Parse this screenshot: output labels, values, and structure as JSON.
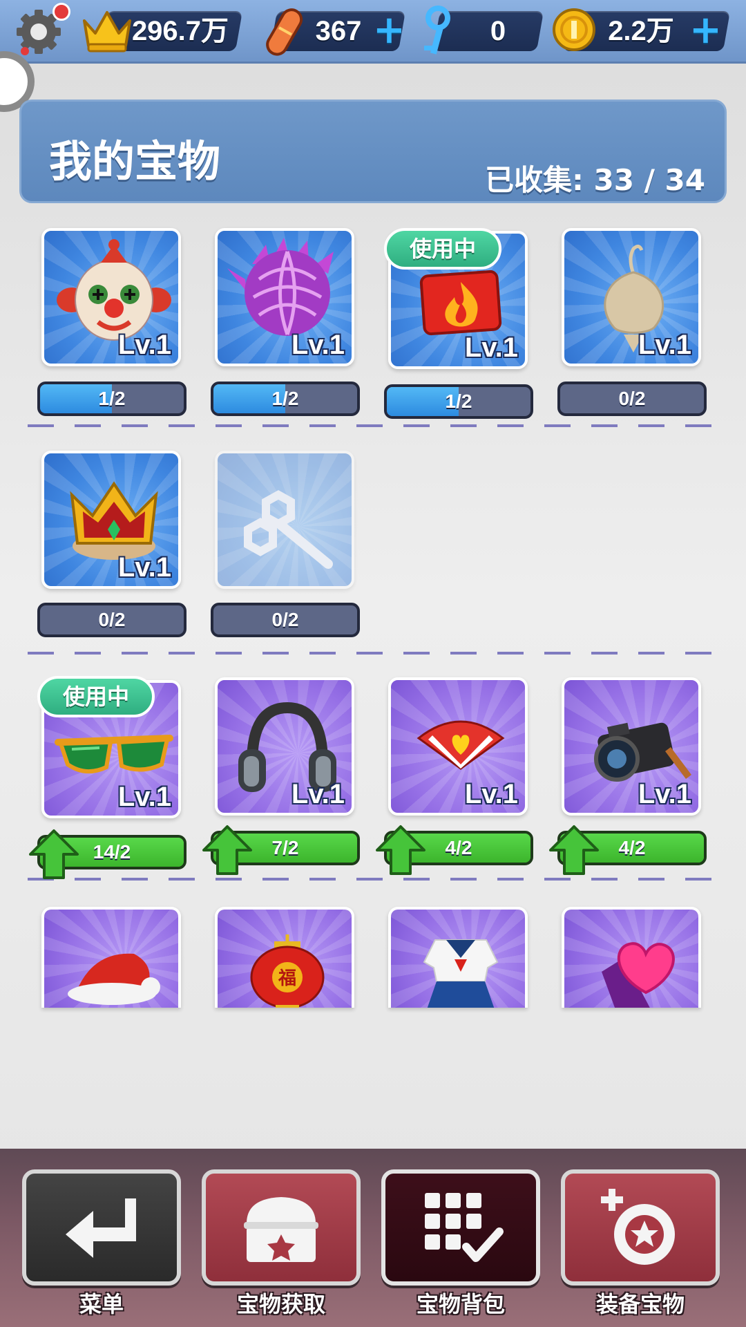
{
  "topbar": {
    "icons": [
      "settings-gear-icon",
      "crown-icon",
      "hoverboard-icon",
      "key-icon",
      "coin-icon"
    ],
    "crowns": "296.7万",
    "hoverboards": "367",
    "keys": "0",
    "coins": "2.2万",
    "plus": "+"
  },
  "header": {
    "title": "我的宝物",
    "collected_label": "已收集:",
    "collected_value": "33 / 34"
  },
  "badge": {
    "in_use": "使用中"
  },
  "items": [
    {
      "icon": "clown-mask-icon",
      "level": "Lv.1",
      "progress_text": "1/2",
      "progress": 0.5,
      "color": "blue"
    },
    {
      "icon": "purple-flower-icon",
      "level": "Lv.1",
      "progress_text": "1/2",
      "progress": 0.5,
      "color": "blue"
    },
    {
      "icon": "fire-badge-icon",
      "level": "Lv.1",
      "progress_text": "1/2",
      "progress": 0.5,
      "color": "blue",
      "in_use": true
    },
    {
      "icon": "onion-charm-icon",
      "level": "Lv.1",
      "progress_text": "0/2",
      "progress": 0,
      "color": "blue"
    },
    {
      "icon": "golden-crown-icon",
      "level": "Lv.1",
      "progress_text": "0/2",
      "progress": 0,
      "color": "blue"
    },
    {
      "icon": "wind-up-key-icon",
      "progress_text": "0/2",
      "progress": 0,
      "color": "blue",
      "locked": true
    },
    {
      "icon": "sunglasses-icon",
      "level": "Lv.1",
      "progress_text": "14/2",
      "progress": 1,
      "color": "purple",
      "in_use": true,
      "upgradable": true
    },
    {
      "icon": "headphones-icon",
      "level": "Lv.1",
      "progress_text": "7/2",
      "progress": 1,
      "color": "purple",
      "upgradable": true
    },
    {
      "icon": "heart-fan-icon",
      "level": "Lv.1",
      "progress_text": "4/2",
      "progress": 1,
      "color": "purple",
      "upgradable": true
    },
    {
      "icon": "camera-icon",
      "level": "Lv.1",
      "progress_text": "4/2",
      "progress": 1,
      "color": "purple",
      "upgradable": true
    },
    {
      "icon": "santa-hat-icon",
      "color": "purple"
    },
    {
      "icon": "red-lantern-icon",
      "color": "purple"
    },
    {
      "icon": "sailor-uniform-icon",
      "color": "purple"
    },
    {
      "icon": "heart-gem-icon",
      "color": "purple"
    }
  ],
  "lantern_char": "福",
  "nav": [
    {
      "label": "菜单",
      "icon": "return-arrow-icon"
    },
    {
      "label": "宝物获取",
      "icon": "treasure-chest-icon"
    },
    {
      "label": "宝物背包",
      "icon": "grid-check-icon"
    },
    {
      "label": "装备宝物",
      "icon": "equip-badge-icon"
    }
  ]
}
